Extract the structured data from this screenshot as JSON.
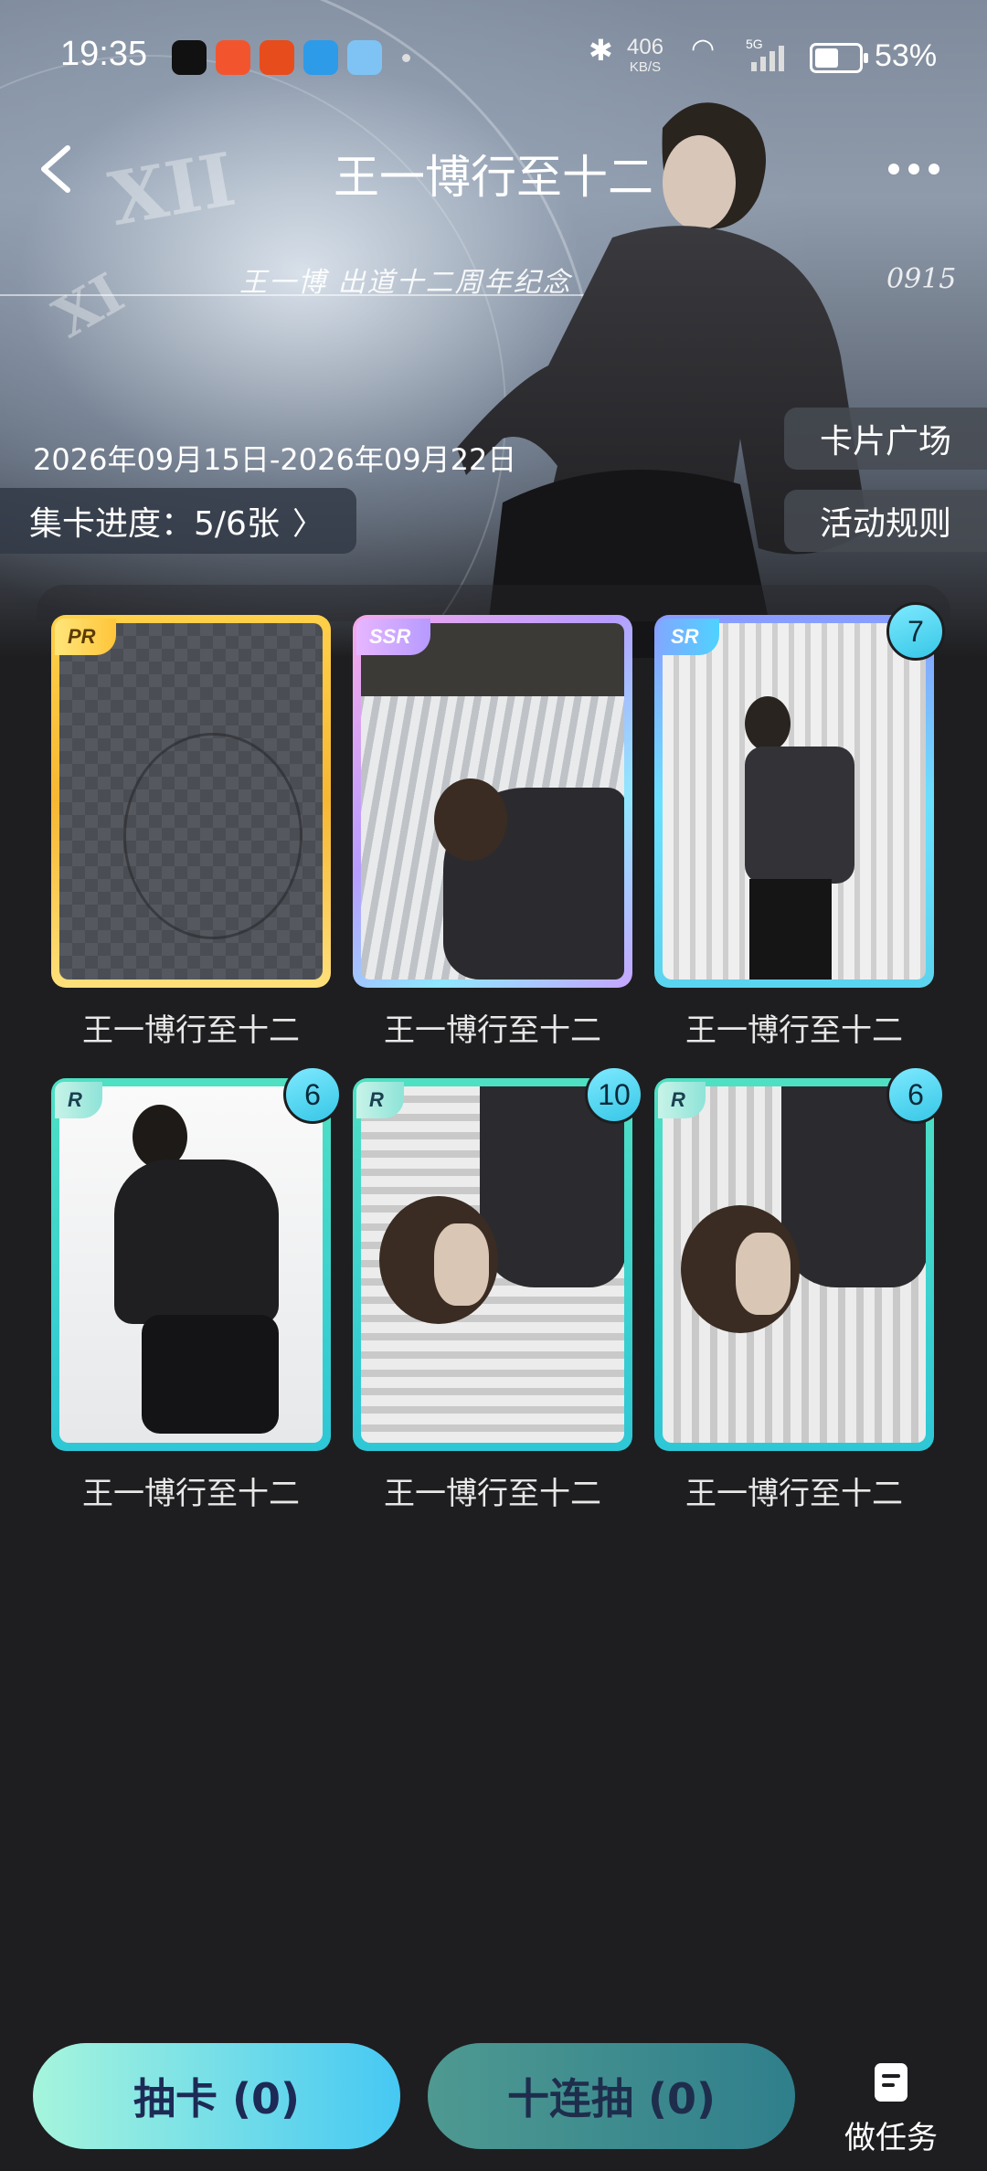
{
  "status_bar": {
    "time": "19:35",
    "net_speed_value": "406",
    "net_speed_unit": "KB/S",
    "network": "5G",
    "battery": "53%"
  },
  "header": {
    "title": "王一博行至十二",
    "subtitle": "王一博    出道十二周年纪念",
    "code": "0915"
  },
  "event": {
    "date_range": "2026年09月15日-2026年09月22日",
    "progress": "集卡进度：5/6张",
    "plaza": "卡片广场",
    "rules": "活动规则"
  },
  "cards": [
    {
      "name": "王一博行至十二",
      "rarity": "PR",
      "count": ""
    },
    {
      "name": "王一博行至十二",
      "rarity": "SSR",
      "count": ""
    },
    {
      "name": "王一博行至十二",
      "rarity": "SR",
      "count": "7"
    },
    {
      "name": "王一博行至十二",
      "rarity": "R",
      "count": "6"
    },
    {
      "name": "王一博行至十二",
      "rarity": "R",
      "count": "10"
    },
    {
      "name": "王一博行至十二",
      "rarity": "R",
      "count": "6"
    }
  ],
  "bottom": {
    "draw_one": "抽卡 (0)",
    "draw_ten": "十连抽 (0)",
    "tasks": "做任务"
  },
  "colors": {
    "background": "#1e1e20",
    "draw_one_gradient": [
      "#9ff5dc",
      "#48c9f2"
    ],
    "draw_ten": "#3f8a8e"
  }
}
